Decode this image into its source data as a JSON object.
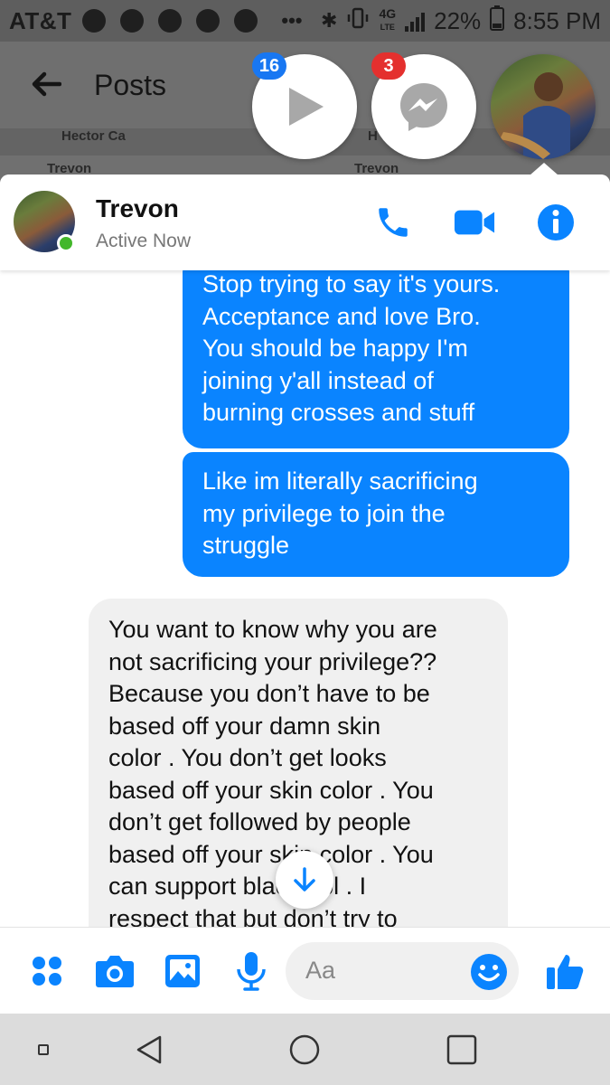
{
  "status_bar": {
    "carrier": "AT&T",
    "more": "•••",
    "network": "4G",
    "network_sub": "LTE",
    "battery": "22%",
    "time": "8:55 PM"
  },
  "background": {
    "back_icon": "back-arrow-icon",
    "title": "Posts",
    "strip_names": [
      "Hector Ca",
      "Trevon",
      "Trevon",
      "H"
    ]
  },
  "chat_heads": [
    {
      "icon": "video-play-icon",
      "badge": "16"
    },
    {
      "icon": "messenger-icon",
      "badge": "3"
    },
    {
      "icon": "trevon-avatar"
    }
  ],
  "conversation": {
    "name": "Trevon",
    "status": "Active Now",
    "actions": [
      "phone-icon",
      "video-call-icon",
      "info-icon"
    ]
  },
  "messages": [
    {
      "direction": "out",
      "lines": [
        "Stop trying to say it's yours.",
        "Acceptance and love Bro.",
        "You should be happy I'm",
        "joining y'all instead of",
        "burning crosses and stuff"
      ]
    },
    {
      "direction": "out",
      "lines": [
        "Like im literally sacrificing",
        "my privilege to join the",
        "struggle"
      ]
    },
    {
      "direction": "in",
      "lines": [
        "You want to know why you are",
        "not sacrificing your privilege??",
        "Because you don’t have to be",
        "based off your damn skin",
        "color . You don’t get looks",
        "based off your skin color . You",
        "don’t get followed by people",
        "based off your skin color . You",
        "can support black ppl . I",
        "respect that but don’t try to"
      ]
    }
  ],
  "composer": {
    "placeholder": "Aa",
    "icons": [
      "apps-icon",
      "camera-icon",
      "gallery-icon",
      "microphone-icon",
      "emoji-icon",
      "thumbs-up-icon"
    ]
  },
  "colors": {
    "messenger_blue": "#0a84ff",
    "accent_blue": "#1877f2",
    "badge_red": "#e4302e",
    "online_green": "#42b72a"
  }
}
